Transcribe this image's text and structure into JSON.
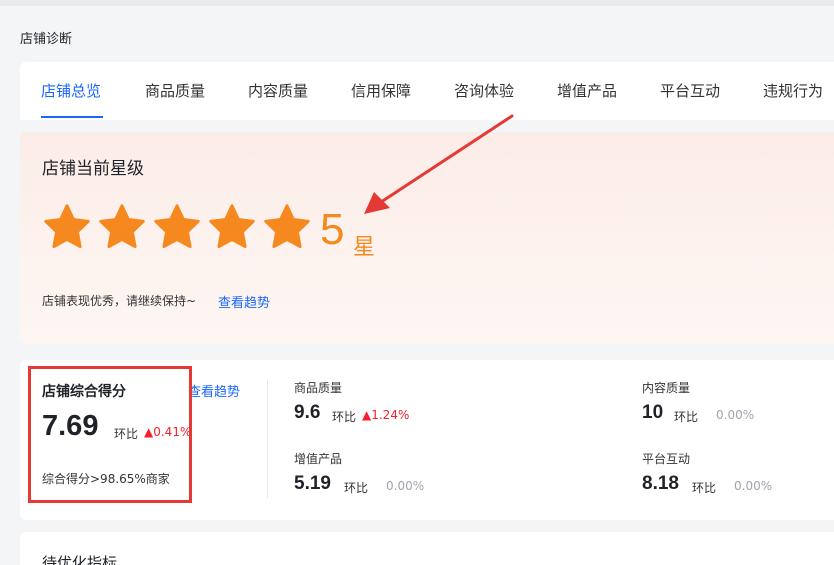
{
  "page": {
    "title": "店铺诊断"
  },
  "tabs": [
    {
      "label": "店铺总览",
      "active": true
    },
    {
      "label": "商品质量",
      "active": false
    },
    {
      "label": "内容质量",
      "active": false
    },
    {
      "label": "信用保障",
      "active": false
    },
    {
      "label": "咨询体验",
      "active": false
    },
    {
      "label": "增值产品",
      "active": false
    },
    {
      "label": "平台互动",
      "active": false
    },
    {
      "label": "违规行为",
      "active": false
    }
  ],
  "star_level": {
    "title": "店铺当前星级",
    "stars": 5,
    "value": "5",
    "unit": "星",
    "description": "店铺表现优秀，请继续保持~",
    "trend_link": "查看趋势",
    "star_color": "#f5891f"
  },
  "overall_score": {
    "label": "店铺综合得分",
    "trend_link": "查看趋势",
    "value": "7.69",
    "mom_label": "环比",
    "change": "0.41%",
    "change_direction": "up",
    "rank_text": "综合得分>98.65%商家"
  },
  "metrics": [
    {
      "label": "商品质量",
      "value": "9.6",
      "mom_label": "环比",
      "change": "1.24%",
      "direction": "up"
    },
    {
      "label": "内容质量",
      "value": "10",
      "mom_label": "环比",
      "change": "0.00%",
      "direction": "flat"
    },
    {
      "label": "增值产品",
      "value": "5.19",
      "mom_label": "环比",
      "change": "0.00%",
      "direction": "flat"
    },
    {
      "label": "平台互动",
      "value": "8.18",
      "mom_label": "环比",
      "change": "0.00%",
      "direction": "flat"
    }
  ],
  "pending": {
    "title": "待优化指标"
  },
  "colors": {
    "accent": "#1a66ff",
    "up": "#f5222d",
    "star": "#f5891f",
    "annotation": "#e53935"
  },
  "icons": {
    "up_arrow": "arrow-up-icon",
    "star": "star-icon"
  }
}
